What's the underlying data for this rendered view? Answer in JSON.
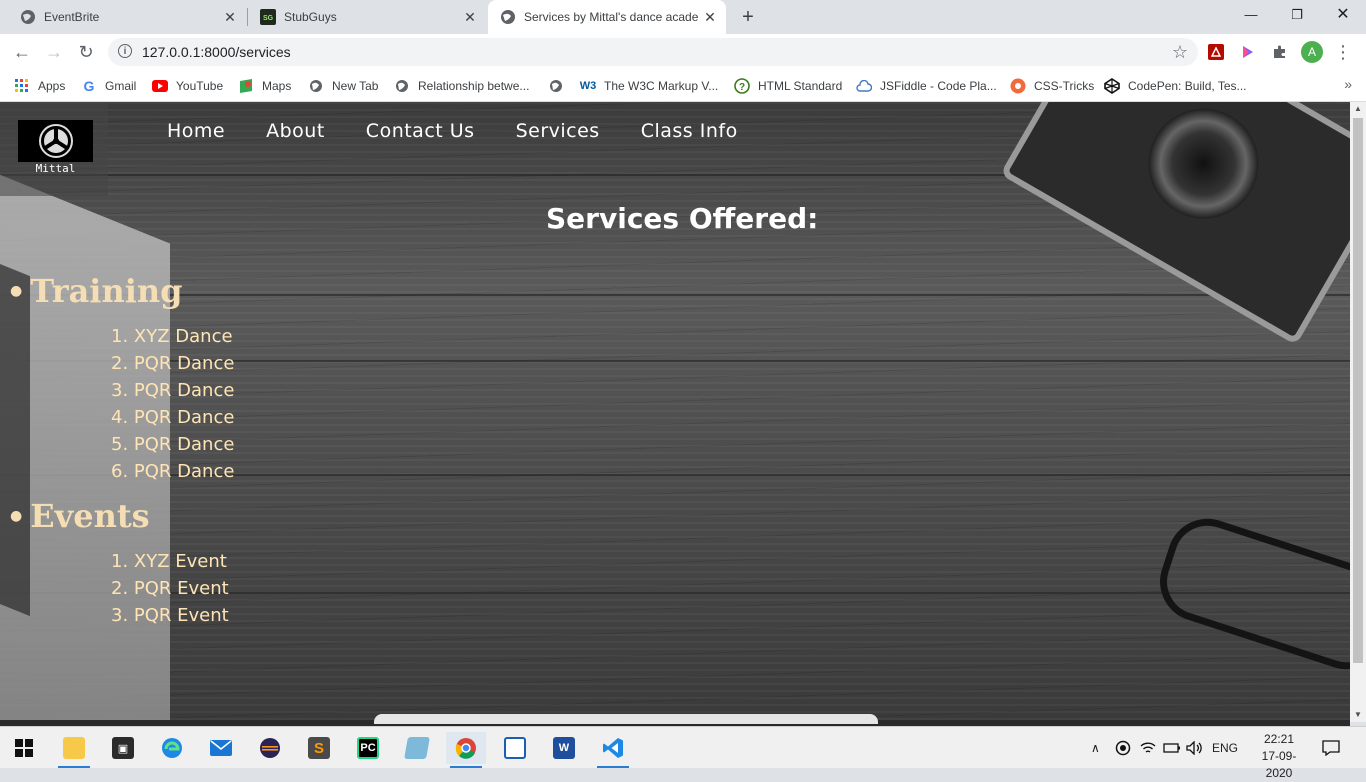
{
  "browser": {
    "tabs": [
      {
        "title": "EventBrite",
        "icon": "globe-icon"
      },
      {
        "title": "StubGuys",
        "icon": "sg-icon"
      },
      {
        "title": "Services by Mittal's dance acader",
        "icon": "globe-icon",
        "active": true
      }
    ],
    "address": "127.0.0.1:8000/services",
    "profile_initial": "A",
    "bookmarks": [
      {
        "label": "Apps",
        "icon": "apps-grid-icon"
      },
      {
        "label": "Gmail",
        "icon": "google-icon"
      },
      {
        "label": "YouTube",
        "icon": "youtube-icon"
      },
      {
        "label": "Maps",
        "icon": "maps-icon"
      },
      {
        "label": "New Tab",
        "icon": "globe-icon"
      },
      {
        "label": "Relationship betwe...",
        "icon": "globe-icon"
      },
      {
        "label": "",
        "icon": "globe-icon"
      },
      {
        "label": "The W3C Markup V...",
        "icon": "w3c-icon"
      },
      {
        "label": "HTML Standard",
        "icon": "question-icon"
      },
      {
        "label": "JSFiddle - Code Pla...",
        "icon": "cloud-icon"
      },
      {
        "label": "CSS-Tricks",
        "icon": "css-tricks-icon"
      },
      {
        "label": "CodePen: Build, Tes...",
        "icon": "codepen-icon"
      }
    ]
  },
  "site": {
    "logo_caption": "Mittal",
    "nav": [
      "Home",
      "About",
      "Contact Us",
      "Services",
      "Class Info"
    ],
    "heading": "Services Offered:",
    "sections": [
      {
        "title": "Training",
        "items": [
          "1. XYZ Dance",
          "2. PQR Dance",
          "3. PQR Dance",
          "4. PQR Dance",
          "5. PQR Dance",
          "6. PQR Dance"
        ]
      },
      {
        "title": "Events",
        "items": [
          "1. XYZ Event",
          "2. PQR Event",
          "3. PQR Event"
        ]
      }
    ]
  },
  "taskbar": {
    "lang": "ENG",
    "time": "22:21",
    "date": "17-09-2020"
  },
  "colors": {
    "section_title": "#f5deb3",
    "list_text": "#ffe4b5",
    "accent": "#2b7cd3"
  }
}
